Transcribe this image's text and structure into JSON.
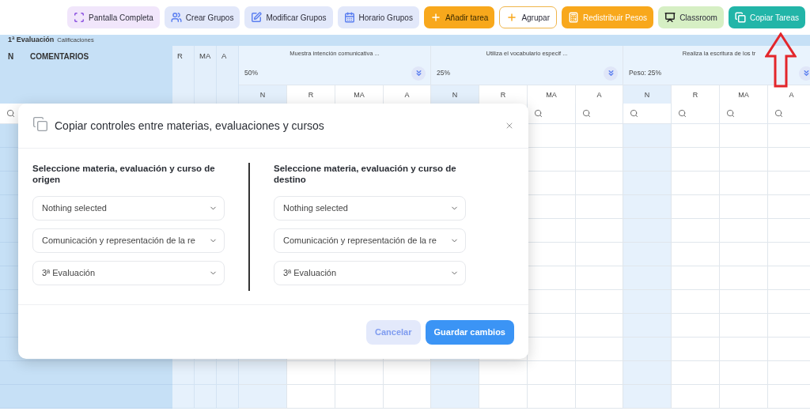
{
  "toolbar": {
    "buttons": [
      {
        "label": "Pantalla Completa",
        "kind": "fullscreen"
      },
      {
        "label": "Crear Grupos",
        "kind": "groups"
      },
      {
        "label": "Modificar Grupos",
        "kind": "edit"
      },
      {
        "label": "Horario Grupos",
        "kind": "schedule"
      },
      {
        "label": "Añadir tarea",
        "kind": "add"
      },
      {
        "label": "Agrupar",
        "kind": "group"
      },
      {
        "label": "Redistribuir Pesos",
        "kind": "calculator"
      },
      {
        "label": "Classroom",
        "kind": "classroom"
      },
      {
        "label": "Copiar Tareas",
        "kind": "copy"
      }
    ]
  },
  "grade_table": {
    "title": "1ª Evaluación",
    "subtitle": "Calificaciones",
    "number_column": "N",
    "comments_column": "COMENTARIOS",
    "level_columns": [
      "R",
      "MA",
      "A"
    ],
    "criteria": [
      {
        "title": "Muestra intención comunicativa ...",
        "weight": "50%",
        "subcolumns": [
          "N",
          "R",
          "MA",
          "A"
        ]
      },
      {
        "title": "Utiliza el vocabulario especif ...",
        "weight": "25%",
        "subcolumns": [
          "N",
          "R",
          "MA",
          "A"
        ]
      },
      {
        "title": "Realiza la escritura de los tr",
        "weight": "Peso: 25%",
        "subcolumns": [
          "N",
          "R",
          "MA",
          "A"
        ]
      }
    ]
  },
  "dialog": {
    "title": "Copiar controles entre materias, evaluaciones y cursos",
    "panels": [
      {
        "heading": "Seleccione materia, evaluación y curso de origen",
        "selects": [
          "Nothing selected",
          "Comunicación y representación de la re",
          "3ª Evaluación"
        ]
      },
      {
        "heading": "Seleccione materia, evaluación y curso de destino",
        "selects": [
          "Nothing selected",
          "Comunicación y representación de la re",
          "3ª Evaluación"
        ]
      }
    ],
    "buttons": [
      {
        "label": "Cancelar",
        "kind": "secondary"
      },
      {
        "label": "Guardar cambios",
        "kind": "primary"
      }
    ]
  }
}
